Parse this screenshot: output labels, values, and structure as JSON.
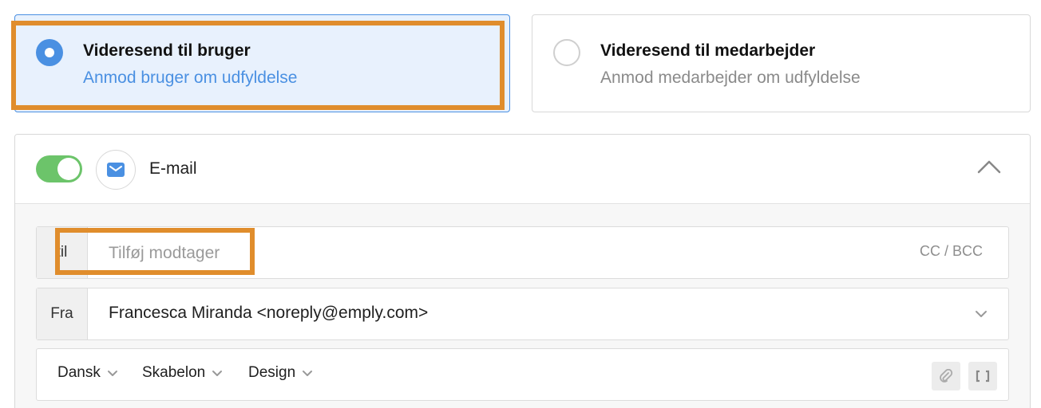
{
  "forward_options": {
    "user": {
      "title": "Videresend til bruger",
      "subtitle": "Anmod bruger om udfyldelse",
      "selected": true
    },
    "employee": {
      "title": "Videresend til medarbejder",
      "subtitle": "Anmod medarbejder om udfyldelse",
      "selected": false
    }
  },
  "email": {
    "enabled": true,
    "label": "E-mail",
    "to": {
      "label": "til",
      "placeholder": "Tilføj modtager",
      "value": "",
      "cc_bcc": "CC / BCC"
    },
    "from": {
      "label": "Fra",
      "value": "Francesca Miranda <noreply@emply.com>"
    },
    "toolbar": {
      "language": "Dansk",
      "template": "Skabelon",
      "design": "Design"
    }
  },
  "colors": {
    "accent": "#4a90e2",
    "highlight": "#e08d2c",
    "toggle_on": "#6cc46a"
  },
  "icons": [
    "radio-selected-icon",
    "radio-unselected-icon",
    "mail-icon",
    "chevron-up-icon",
    "chevron-down-icon",
    "paperclip-icon",
    "brackets-icon"
  ]
}
